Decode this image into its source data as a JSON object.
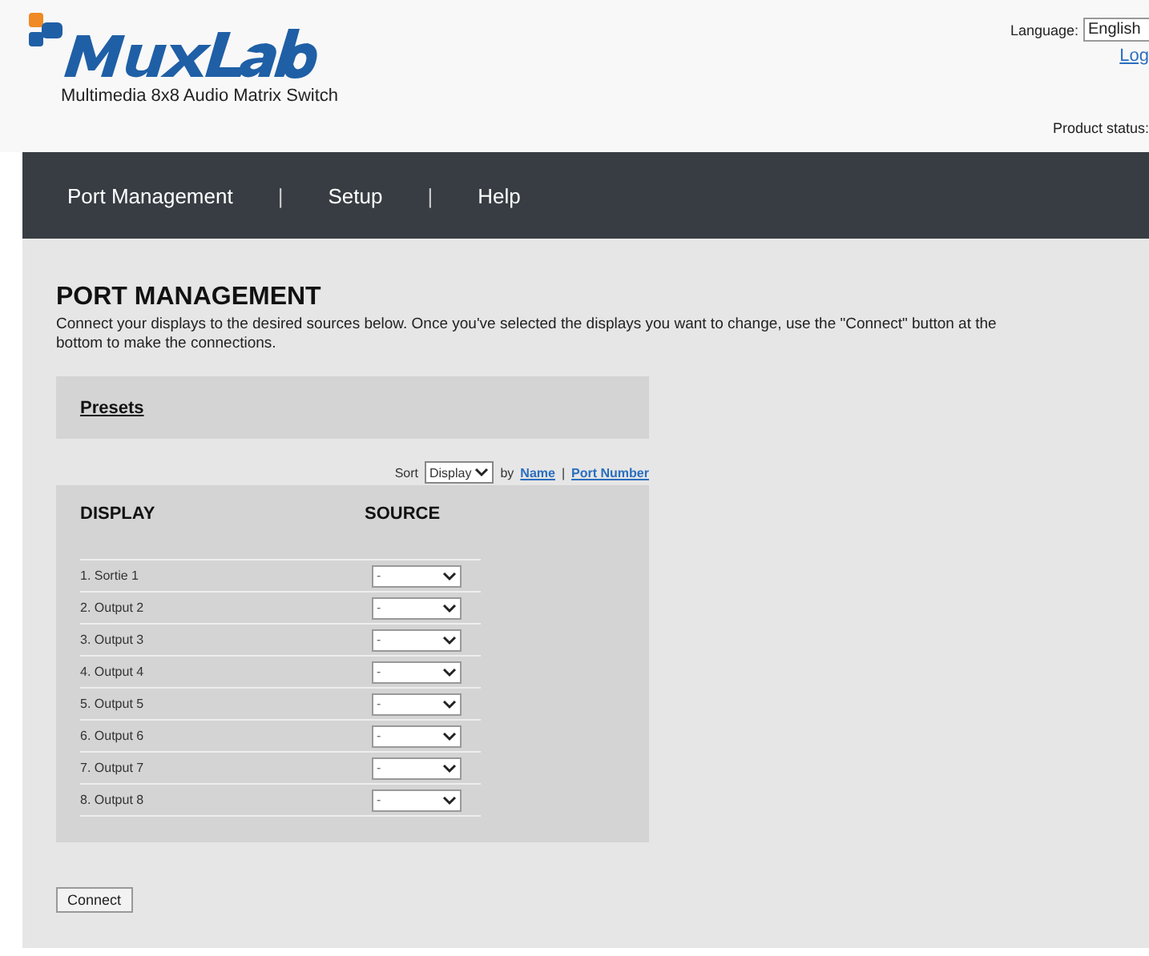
{
  "header": {
    "subtitle": "Multimedia 8x8 Audio Matrix Switch",
    "language_label": "Language:",
    "language_value": "English",
    "logout_link": "Log",
    "product_status_label": "Product status:"
  },
  "nav": {
    "items": [
      {
        "label": "Port Management"
      },
      {
        "label": "Setup"
      },
      {
        "label": "Help"
      }
    ],
    "separator": "|"
  },
  "page": {
    "title": "PORT MANAGEMENT",
    "description": "Connect your displays to the desired sources below. Once you've selected the displays you want to change, use the \"Connect\" button at the bottom to make the connections."
  },
  "presets": {
    "label": "Presets"
  },
  "sort": {
    "label": "Sort",
    "value": "Display",
    "by": "by",
    "links": [
      "Name",
      "Port Number"
    ],
    "separator": "|"
  },
  "table": {
    "columns": [
      "DISPLAY",
      "SOURCE"
    ],
    "rows": [
      {
        "display": "1. Sortie 1",
        "source": "-"
      },
      {
        "display": "2. Output 2",
        "source": "-"
      },
      {
        "display": "3. Output 3",
        "source": "-"
      },
      {
        "display": "4. Output 4",
        "source": "-"
      },
      {
        "display": "5. Output 5",
        "source": "-"
      },
      {
        "display": "6. Output 6",
        "source": "-"
      },
      {
        "display": "7. Output 7",
        "source": "-"
      },
      {
        "display": "8. Output 8",
        "source": "-"
      }
    ]
  },
  "connect_button": "Connect"
}
